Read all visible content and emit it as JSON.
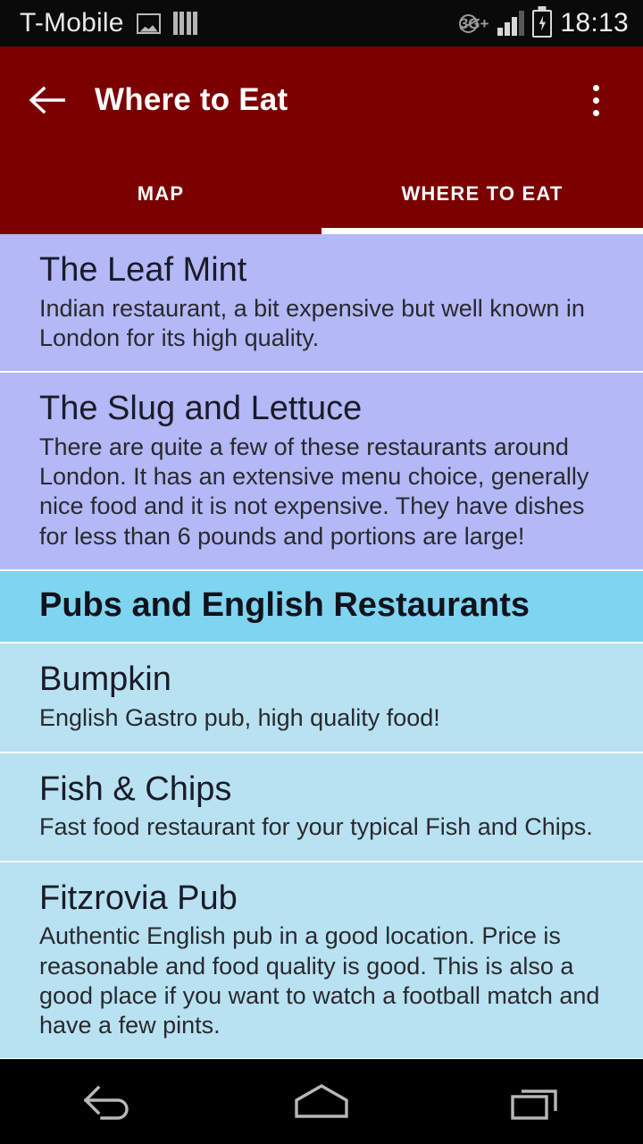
{
  "status_bar": {
    "carrier": "T-Mobile",
    "time": "18:13",
    "network_label": "3G+",
    "icons": [
      "photo-icon",
      "sim-bars-icon",
      "no-data-3g-icon",
      "signal-icon",
      "battery-charging-icon"
    ]
  },
  "app_bar": {
    "title": "Where to Eat",
    "back_icon": "arrow-back-icon",
    "overflow_icon": "overflow-menu-icon"
  },
  "tabs": {
    "items": [
      {
        "label": "MAP",
        "active": false
      },
      {
        "label": "WHERE TO EAT",
        "active": true
      }
    ]
  },
  "list": {
    "items": [
      {
        "kind": "item",
        "style": "lavender",
        "title": "The Leaf Mint",
        "description": "Indian restaurant, a bit expensive but well known in London for its high quality."
      },
      {
        "kind": "item",
        "style": "lavender",
        "title": "The Slug and Lettuce",
        "description": "There are quite a few of these restaurants around London. It has an extensive menu choice, generally nice food and it is not expensive. They have dishes for less than 6 pounds and portions are large!"
      },
      {
        "kind": "header",
        "style": "blue-header",
        "title": "Pubs and English Restaurants"
      },
      {
        "kind": "item",
        "style": "blue",
        "title": "Bumpkin",
        "description": "English Gastro pub, high quality food!"
      },
      {
        "kind": "item",
        "style": "blue",
        "title": "Fish & Chips",
        "description": "Fast food restaurant for your typical Fish and Chips."
      },
      {
        "kind": "item",
        "style": "blue",
        "title": "Fitzrovia Pub",
        "description": "Authentic English pub in a good location. Price is reasonable and food quality is good. This is also a good place if you want to watch a football match and have a few pints."
      }
    ]
  },
  "nav_bar": {
    "buttons": [
      {
        "name": "back-button",
        "icon": "nav-back-icon"
      },
      {
        "name": "home-button",
        "icon": "nav-home-icon"
      },
      {
        "name": "recents-button",
        "icon": "nav-recents-icon"
      }
    ]
  },
  "colors": {
    "app_bar": "#7B0000",
    "lavender_row": "#B3B8F7",
    "blue_row": "#B8E2F2",
    "section_header": "#7FD4F0"
  }
}
